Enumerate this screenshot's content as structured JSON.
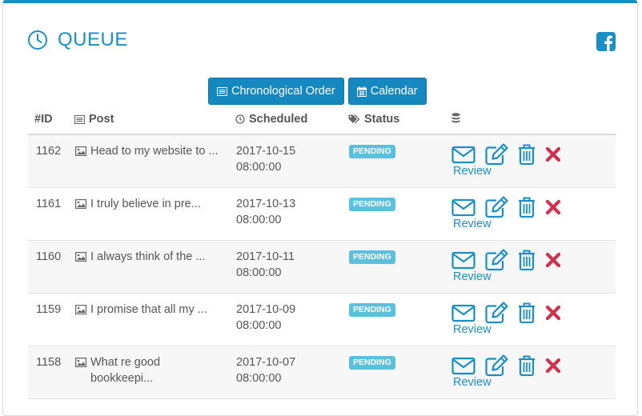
{
  "header": {
    "title": "QUEUE",
    "clock_icon": "clock-icon",
    "facebook_icon": "facebook-icon"
  },
  "colors": {
    "accent": "#1a8fc6",
    "button": "#1688c0",
    "badge": "#5bc0de",
    "delete": "#d0314f"
  },
  "buttons": {
    "chronological": "Chronological Order",
    "calendar": "Calendar"
  },
  "table": {
    "columns": {
      "id": "#ID",
      "post": "Post",
      "scheduled": "Scheduled",
      "status": "Status"
    },
    "rows": [
      {
        "id": "1162",
        "post": "Head to my website to ...",
        "date": "2017-10-15",
        "time": "08:00:00",
        "status": "PENDING",
        "review": "Review"
      },
      {
        "id": "1161",
        "post": "I truly believe in pre...",
        "date": "2017-10-13",
        "time": "08:00:00",
        "status": "PENDING",
        "review": "Review"
      },
      {
        "id": "1160",
        "post": "I always think of the ...",
        "date": "2017-10-11",
        "time": "08:00:00",
        "status": "PENDING",
        "review": "Review"
      },
      {
        "id": "1159",
        "post": "I promise that all my ...",
        "date": "2017-10-09",
        "time": "08:00:00",
        "status": "PENDING",
        "review": "Review"
      },
      {
        "id": "1158",
        "post": "What re good bookkeepi...",
        "date": "2017-10-07",
        "time": "08:00:00",
        "status": "PENDING",
        "review": "Review"
      }
    ]
  }
}
